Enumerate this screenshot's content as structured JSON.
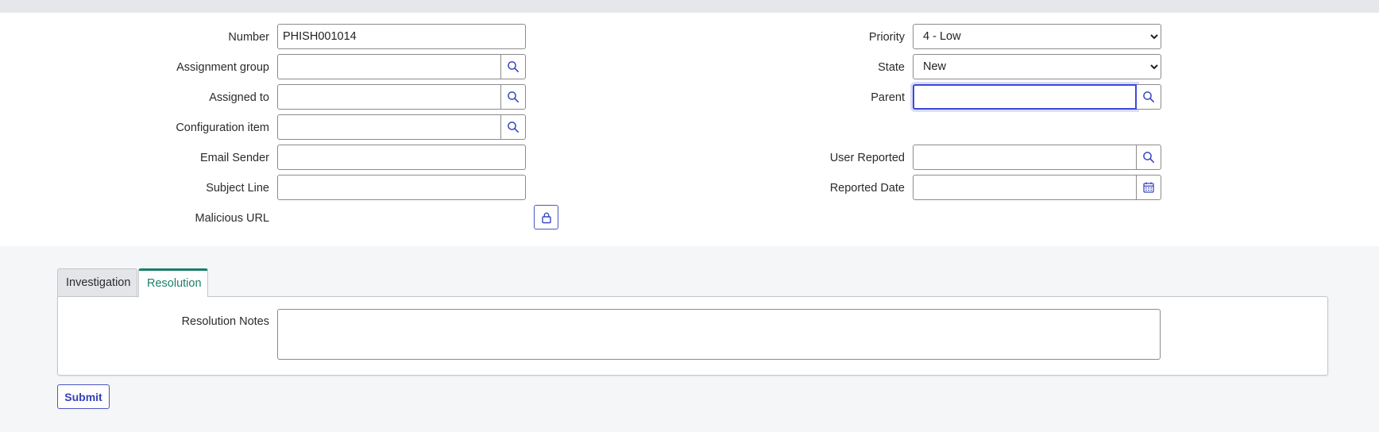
{
  "form": {
    "left": {
      "number_label": "Number",
      "number_value": "PHISH001014",
      "assignment_group_label": "Assignment group",
      "assignment_group_value": "",
      "assigned_to_label": "Assigned to",
      "assigned_to_value": "",
      "configuration_item_label": "Configuration item",
      "configuration_item_value": "",
      "email_sender_label": "Email Sender",
      "email_sender_value": "",
      "subject_line_label": "Subject Line",
      "subject_line_value": "",
      "malicious_url_label": "Malicious URL"
    },
    "right": {
      "priority_label": "Priority",
      "priority_selected": "4 - Low",
      "state_label": "State",
      "state_selected": "New",
      "parent_label": "Parent",
      "parent_value": "",
      "user_reported_label": "User Reported",
      "user_reported_value": "",
      "reported_date_label": "Reported Date",
      "reported_date_value": ""
    }
  },
  "tabs": [
    {
      "label": "Investigation",
      "active": false
    },
    {
      "label": "Resolution",
      "active": true
    }
  ],
  "resolution": {
    "notes_label": "Resolution Notes",
    "notes_value": ""
  },
  "actions": {
    "submit_label": "Submit"
  },
  "icons": {
    "lookup": "search-icon",
    "calendar": "calendar-icon",
    "lock": "lock-icon"
  },
  "colors": {
    "accent": "#3b4ad8",
    "button_text": "#3440b5",
    "active_tab": "#1a7f67"
  }
}
